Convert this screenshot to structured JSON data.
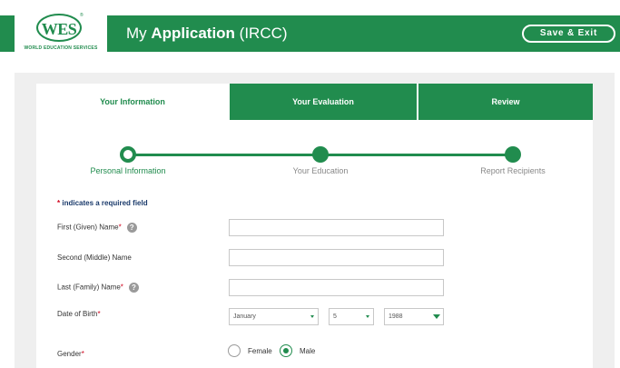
{
  "header": {
    "logo_text": "WES",
    "logo_reg": "®",
    "logo_subtitle": "WORLD EDUCATION SERVICES",
    "title_prefix": "My ",
    "title_bold": "Application",
    "title_suffix": " (IRCC)",
    "save_exit_label": "Save & Exit"
  },
  "tabs": [
    {
      "label": "Your Information",
      "active": true
    },
    {
      "label": "Your Evaluation",
      "active": false
    },
    {
      "label": "Review",
      "active": false
    }
  ],
  "steps": [
    {
      "label": "Personal Information",
      "current": true
    },
    {
      "label": "Your Education",
      "current": false
    },
    {
      "label": "Report Recipients",
      "current": false
    }
  ],
  "form": {
    "required_star": "*",
    "required_note": " indicates a required field",
    "help_glyph": "?",
    "fields": {
      "first_name": {
        "label": "First (Given) Name",
        "required": "*",
        "value": ""
      },
      "middle_name": {
        "label": "Second (Middle) Name",
        "value": ""
      },
      "last_name": {
        "label": "Last (Family) Name",
        "required": "*",
        "value": ""
      },
      "dob": {
        "label": "Date of Birth",
        "required": "*",
        "month": "January",
        "day": "5",
        "year": "1988"
      },
      "gender": {
        "label": "Gender",
        "required": "*",
        "options": [
          "Female",
          "Male"
        ],
        "selected": "Male"
      }
    }
  },
  "colors": {
    "brand_green": "#218c4e",
    "required_red": "#d0021b",
    "navy_text": "#1a3a6b"
  }
}
